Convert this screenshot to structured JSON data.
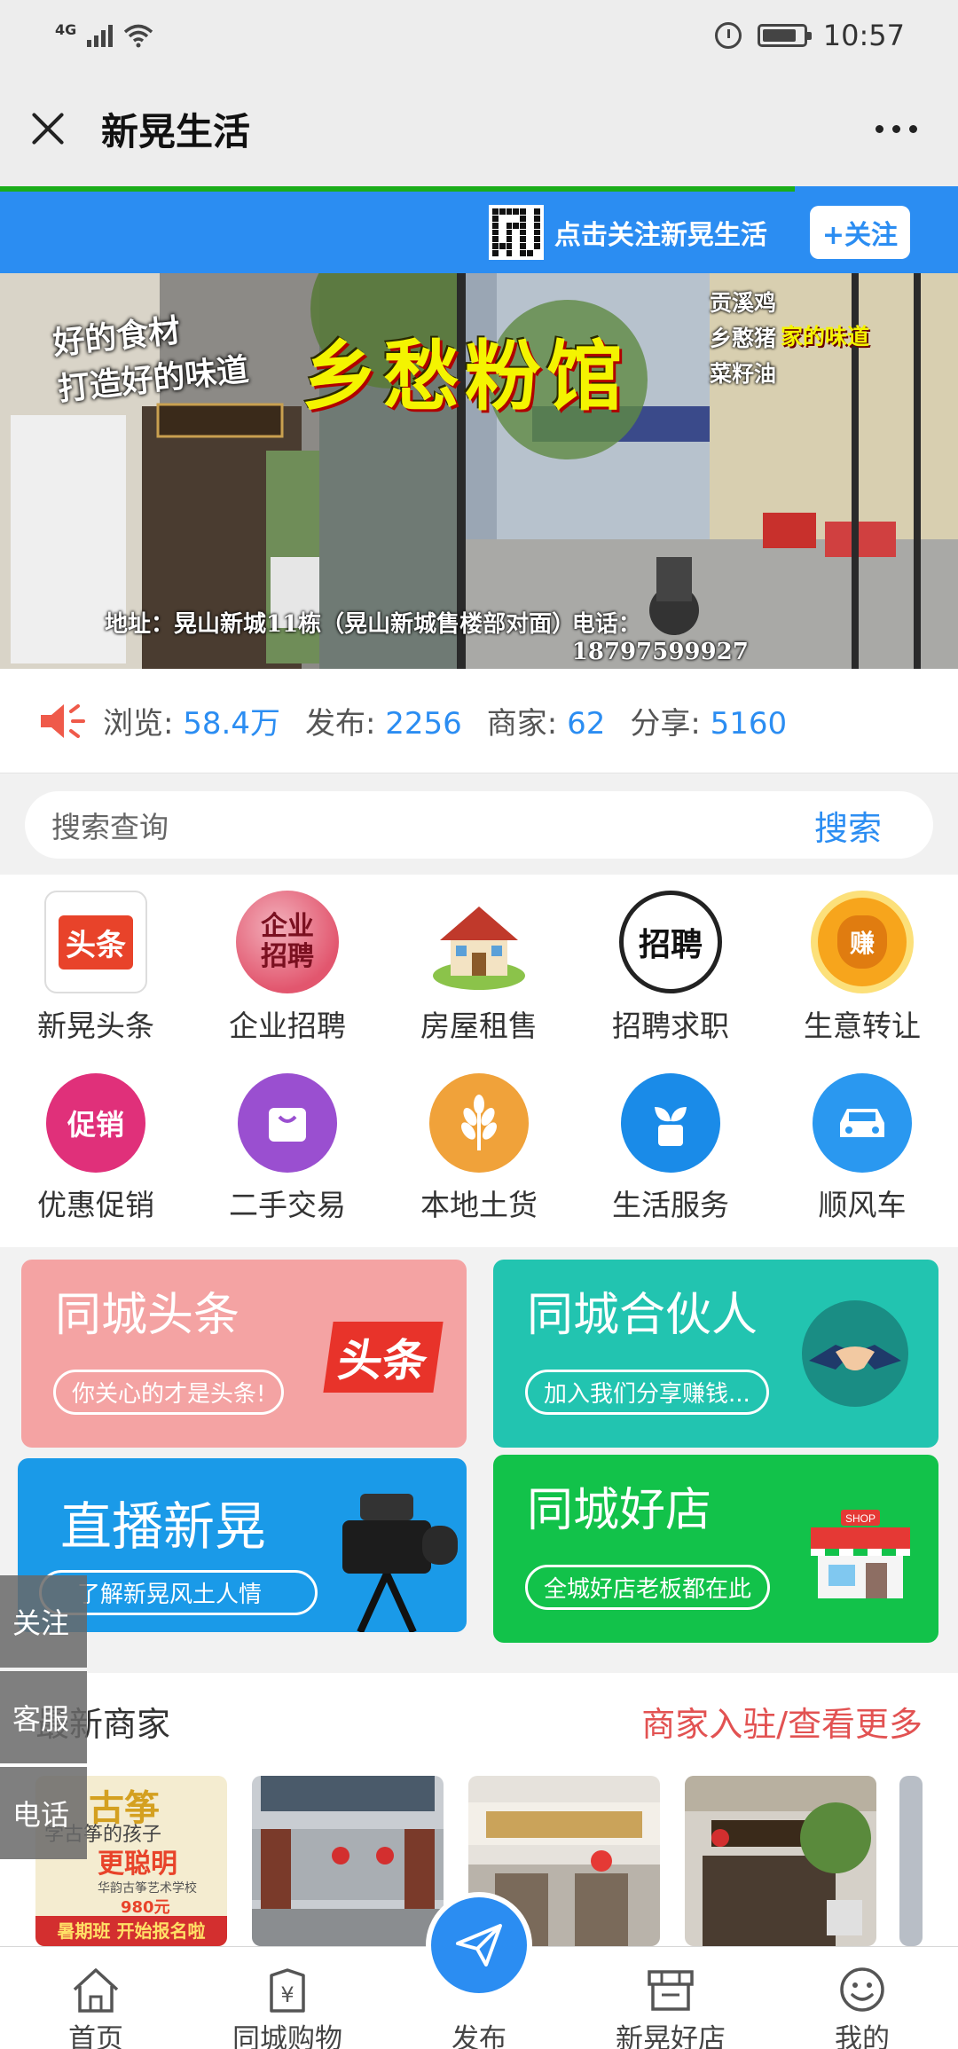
{
  "status_bar": {
    "network": "4G",
    "time": "10:57",
    "battery_level": 0.85
  },
  "titlebar": {
    "title": "新晃生活"
  },
  "page_load_progress": 0.83,
  "follow_bar": {
    "text": "点击关注新晃生活",
    "button_label": "+关注"
  },
  "banner": {
    "slogan_line1": "好的食材",
    "slogan_line2": "打造好的味道",
    "shop_name": "乡愁粉馆",
    "menu_line1": "贡溪鸡",
    "menu_line2": "乡憨猪",
    "menu_line3": "菜籽油",
    "taste": "家的味道",
    "address": "地址：晃山新城11栋（晃山新城售楼部对面）",
    "phone": "电话：18797599927"
  },
  "stats": {
    "views_label": "浏览:",
    "views_value": "58.4万",
    "posts_label": "发布:",
    "posts_value": "2256",
    "merchants_label": "商家:",
    "merchants_value": "62",
    "shares_label": "分享:",
    "shares_value": "5160"
  },
  "search": {
    "placeholder": "搜索查询",
    "button": "搜索"
  },
  "categories": [
    {
      "label": "新晃头条",
      "icon": "headline-icon",
      "glyph": "头条",
      "color": "#e8432a"
    },
    {
      "label": "企业招聘",
      "icon": "recruit-icon",
      "glyph": "企业招聘",
      "color": "#d9324a"
    },
    {
      "label": "房屋租售",
      "icon": "house-icon",
      "glyph": "",
      "color": "#c0392b"
    },
    {
      "label": "招聘求职",
      "icon": "job-seal-icon",
      "glyph": "招聘",
      "color": "#222222"
    },
    {
      "label": "生意转让",
      "icon": "money-bag-icon",
      "glyph": "赚",
      "color": "#f7a51c"
    },
    {
      "label": "优惠促销",
      "icon": "promo-icon",
      "glyph": "促销",
      "color": "#e0307a"
    },
    {
      "label": "二手交易",
      "icon": "shopping-bag-icon",
      "glyph": "",
      "color": "#9a4fd0"
    },
    {
      "label": "本地土货",
      "icon": "wheat-icon",
      "glyph": "",
      "color": "#f0a23a"
    },
    {
      "label": "生活服务",
      "icon": "sprout-icon",
      "glyph": "",
      "color": "#1a8be8"
    },
    {
      "label": "顺风车",
      "icon": "car-icon",
      "glyph": "",
      "color": "#2a98f0"
    }
  ],
  "promo_cards": [
    {
      "title": "同城头条",
      "pill": "你关心的才是头条!",
      "badge": "头条",
      "color": "#f4a3a3"
    },
    {
      "title": "同城合伙人",
      "pill": "加入我们分享赚钱...",
      "color": "#22c4b0"
    },
    {
      "title": "直播新晃",
      "pill": "了解新晃风土人情",
      "color": "#1a9ae8"
    },
    {
      "title": "同城好店",
      "pill": "全城好店老板都在此",
      "shop_sign": "SHOP",
      "color": "#12c24a"
    }
  ],
  "merchants": {
    "title": "最新商家",
    "more": "商家入驻/查看更多",
    "thumb1_text1": "古筝",
    "thumb1_text2": "学古筝的孩子",
    "thumb1_text3": "更聪明",
    "thumb1_text4": "华韵古筝艺术学校",
    "thumb1_text5": "980元",
    "thumb1_text6": "暑期班 开始报名啦"
  },
  "side_buttons": [
    "关注",
    "客服",
    "电话"
  ],
  "bottom_nav": [
    {
      "label": "首页",
      "icon": "home-icon"
    },
    {
      "label": "同城购物",
      "icon": "shopping-icon"
    },
    {
      "label": "发布",
      "icon": "paper-plane-icon"
    },
    {
      "label": "新晃好店",
      "icon": "store-icon"
    },
    {
      "label": "我的",
      "icon": "smiley-icon"
    }
  ],
  "colors": {
    "accent": "#2b8df2",
    "highlight": "#e25252",
    "progress": "#1aad19"
  }
}
